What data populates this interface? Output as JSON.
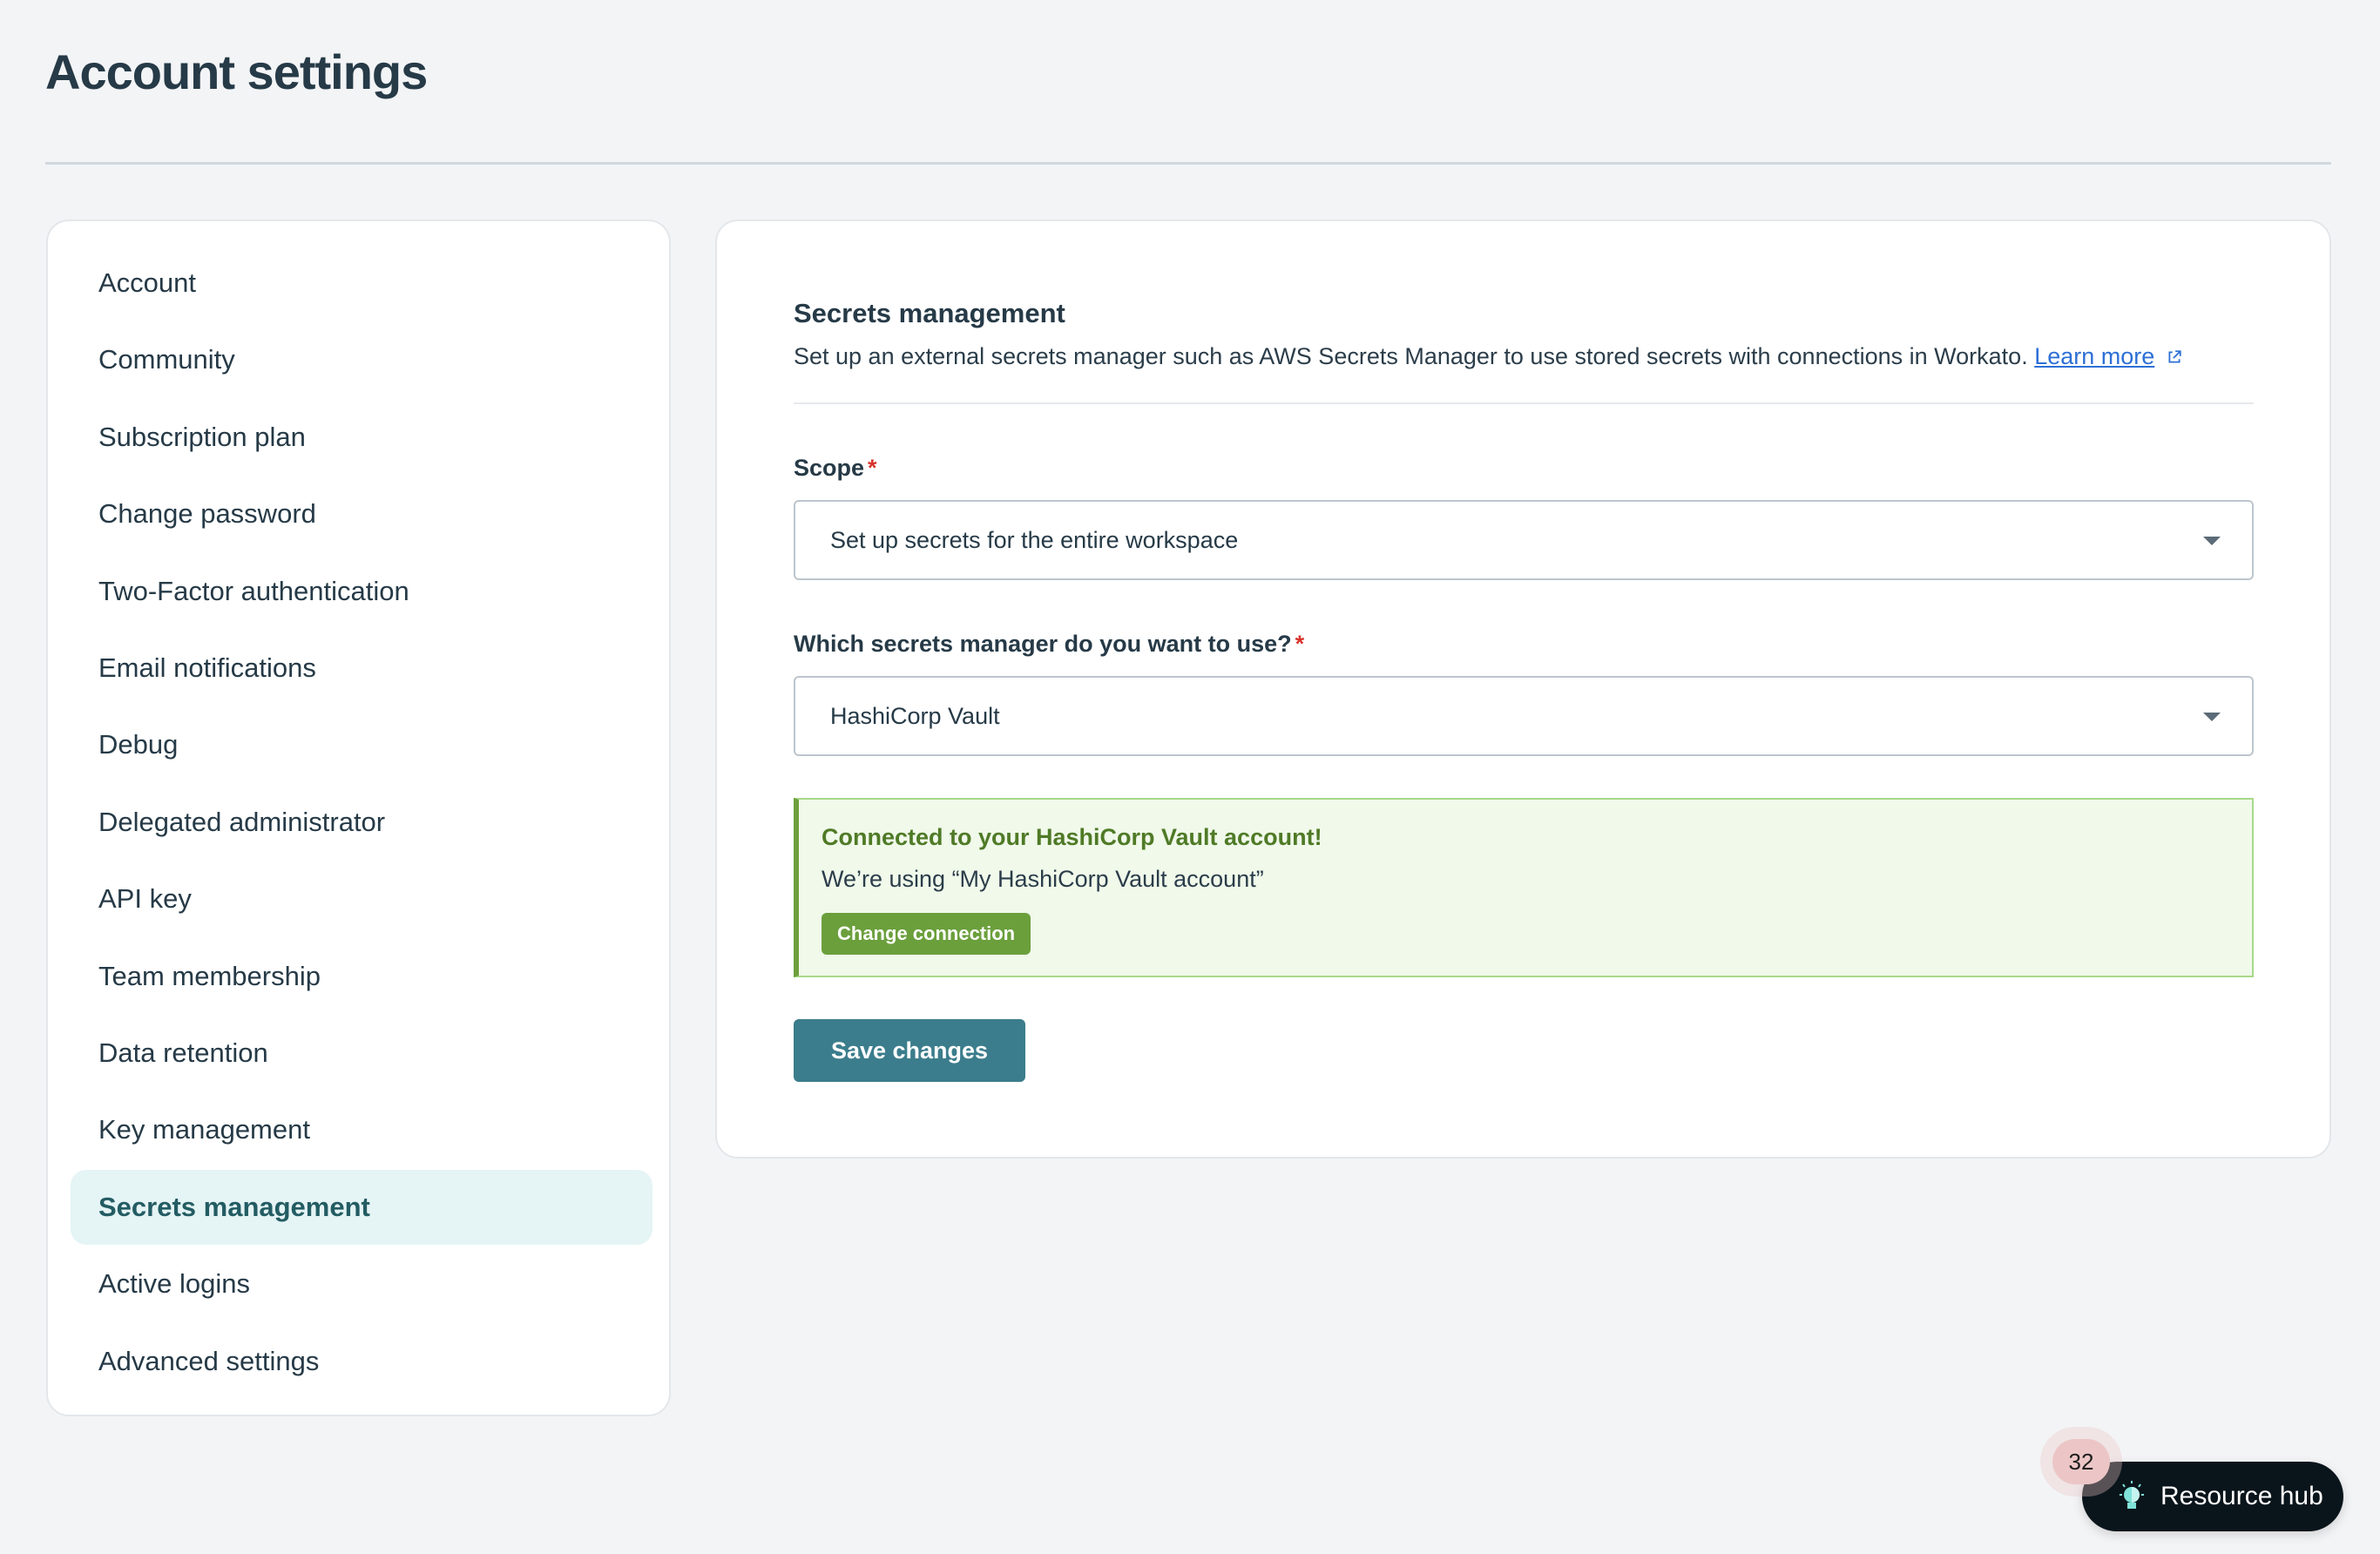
{
  "page": {
    "title": "Account settings"
  },
  "sidebar": {
    "items": [
      {
        "label": "Account",
        "active": false
      },
      {
        "label": "Community",
        "active": false
      },
      {
        "label": "Subscription plan",
        "active": false
      },
      {
        "label": "Change password",
        "active": false
      },
      {
        "label": "Two-Factor authentication",
        "active": false
      },
      {
        "label": "Email notifications",
        "active": false
      },
      {
        "label": "Debug",
        "active": false
      },
      {
        "label": "Delegated administrator",
        "active": false
      },
      {
        "label": "API key",
        "active": false
      },
      {
        "label": "Team membership",
        "active": false
      },
      {
        "label": "Data retention",
        "active": false
      },
      {
        "label": "Key management",
        "active": false
      },
      {
        "label": "Secrets management",
        "active": true
      },
      {
        "label": "Active logins",
        "active": false
      },
      {
        "label": "Advanced settings",
        "active": false
      }
    ]
  },
  "main": {
    "title": "Secrets management",
    "description": "Set up an external secrets manager such as AWS Secrets Manager to use stored secrets with connections in Workato.",
    "learn_more": "Learn more",
    "scope": {
      "label": "Scope",
      "required_mark": "*",
      "value": "Set up secrets for the entire workspace"
    },
    "manager": {
      "label": "Which secrets manager do you want to use?",
      "required_mark": "*",
      "value": "HashiCorp Vault"
    },
    "alert": {
      "title": "Connected to your HashiCorp Vault account!",
      "text": "We’re using “My HashiCorp Vault account”",
      "button": "Change connection"
    },
    "save_label": "Save changes"
  },
  "resource_hub": {
    "label": "Resource hub",
    "badge_count": "32"
  },
  "colors": {
    "accent": "#3b7d8c",
    "success": "#6b9f3c",
    "active_nav_bg": "#e5f4f5",
    "link": "#2d6fd6"
  }
}
